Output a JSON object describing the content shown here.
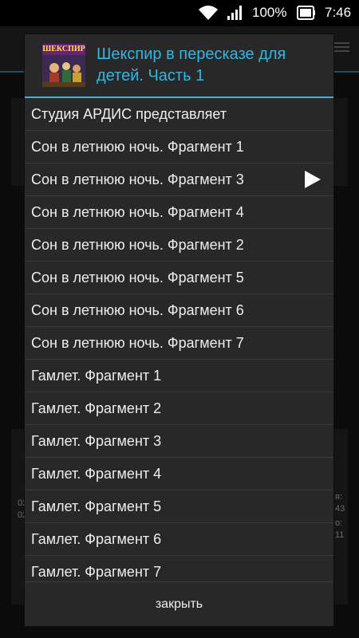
{
  "status_bar": {
    "battery_percent": "100%",
    "time": "7:46",
    "icons": [
      "wifi-icon",
      "signal-icon",
      "battery-icon"
    ]
  },
  "background": {
    "left_lines": [
      "02",
      "02"
    ],
    "right_lines": [
      "я:",
      "43",
      "о:",
      "11"
    ]
  },
  "dialog": {
    "title": "Шекспир в пересказе для детей. Часть 1",
    "cover_text": "ШЕКСПИР",
    "accent_color": "#33b5e5",
    "tracks": [
      "Студия АРДИС представляет",
      "Сон в летнюю ночь. Фрагмент 1",
      "Сон в летнюю ночь. Фрагмент 3",
      "Сон в летнюю ночь. Фрагмент 4",
      "Сон в летнюю ночь. Фрагмент 2",
      "Сон в летнюю ночь. Фрагмент 5",
      "Сон в летнюю ночь. Фрагмент 6",
      "Сон в летнюю ночь. Фрагмент 7",
      "Гамлет. Фрагмент 1",
      "Гамлет. Фрагмент 2",
      "Гамлет. Фрагмент 3",
      "Гамлет. Фрагмент 4",
      "Гамлет. Фрагмент 5",
      "Гамлет. Фрагмент 6",
      "Гамлет. Фрагмент 7"
    ],
    "playing_index": 2,
    "close_label": "закрыть"
  }
}
